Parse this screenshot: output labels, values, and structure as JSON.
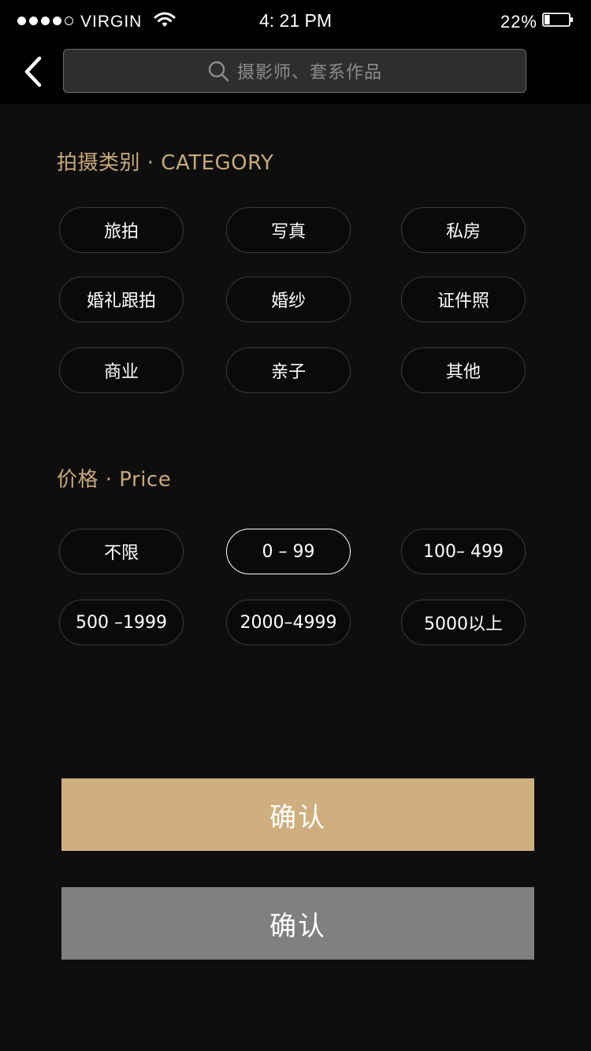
{
  "status_bar": {
    "carrier": "VIRGIN",
    "time": "4: 21 PM",
    "battery": "22%",
    "battery_level": 0.22
  },
  "header": {
    "search_placeholder": "摄影师、套系作品"
  },
  "category": {
    "title": "拍摄类别 · CATEGORY",
    "options": [
      "旅拍",
      "写真",
      "私房",
      "婚礼跟拍",
      "婚纱",
      "证件照",
      "商业",
      "亲子",
      "其他"
    ]
  },
  "price": {
    "title": "价格 · Price",
    "options": [
      "不限",
      "0 – 99",
      "100– 499",
      "500 –1999",
      "2000–4999",
      "5000以上"
    ],
    "selected": "0 – 99"
  },
  "buttons": {
    "confirm_primary": "确认",
    "confirm_secondary": "确认"
  },
  "colors": {
    "accent_gold": "#c9a978",
    "button_gold": "#cfaf7f",
    "button_gray": "#808080",
    "background": "#0e0e0e",
    "header": "#000000"
  }
}
